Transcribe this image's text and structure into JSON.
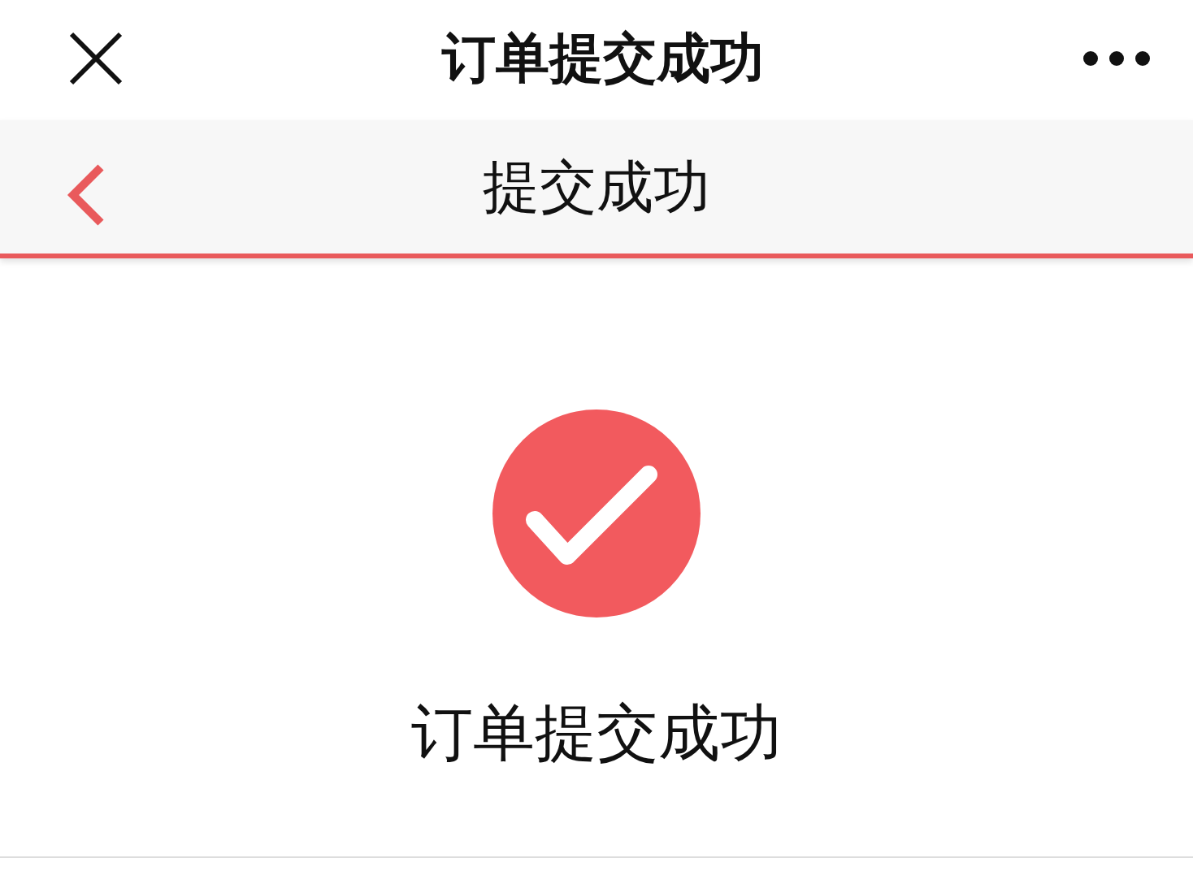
{
  "window": {
    "title": "订单提交成功"
  },
  "nav_bar": {
    "title": "提交成功"
  },
  "result": {
    "kind": "success",
    "message": "订单提交成功"
  }
}
